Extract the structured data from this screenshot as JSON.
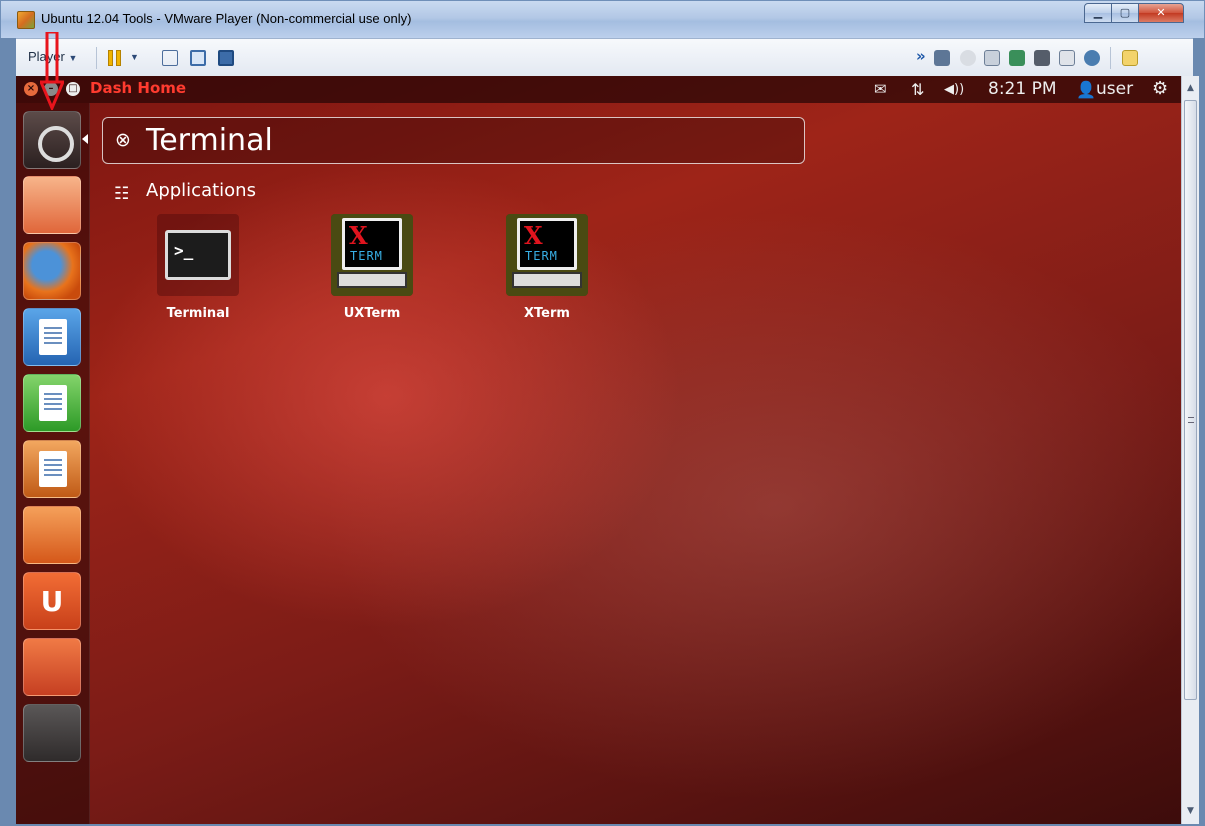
{
  "window": {
    "title": "Ubuntu 12.04 Tools - VMware Player (Non-commercial use only)",
    "min_label": "▁",
    "max_label": "▢",
    "close_label": "✕"
  },
  "toolbar": {
    "player_label": "Player",
    "caret": "▼"
  },
  "panel": {
    "dash_title": "Dash Home",
    "clock": "8:21 PM",
    "user": "user",
    "mail_glyph": "✉",
    "network_glyph": "⇅",
    "volume_glyph": "◀))",
    "user_glyph": "👤",
    "gear_glyph": "⚙",
    "close_glyph": "×",
    "min_glyph": "–",
    "max_glyph": "□"
  },
  "launcher": {
    "items": [
      {
        "name": "Dash Home"
      },
      {
        "name": "Files"
      },
      {
        "name": "Firefox"
      },
      {
        "name": "LibreOffice Writer"
      },
      {
        "name": "LibreOffice Calc"
      },
      {
        "name": "LibreOffice Impress"
      },
      {
        "name": "Ubuntu Software Center"
      },
      {
        "name": "Ubuntu One"
      },
      {
        "name": "System Settings"
      },
      {
        "name": "Workspace Switcher"
      }
    ],
    "ubuntu_one_glyph": "U"
  },
  "dash": {
    "search_value": "Terminal",
    "search_clear_glyph": "⊗",
    "category_label": "Applications",
    "category_glyph": "☷",
    "results": [
      {
        "label": "Terminal"
      },
      {
        "label": "UXTerm"
      },
      {
        "label": "XTerm"
      }
    ],
    "xterm_x": "X",
    "xterm_term": "TERM",
    "terminal_prompt": ">_"
  },
  "scrollbar": {
    "up": "▲",
    "down": "▼"
  },
  "colors": {
    "dash_title": "#ff3b2f",
    "annotation": "#e8141c"
  }
}
